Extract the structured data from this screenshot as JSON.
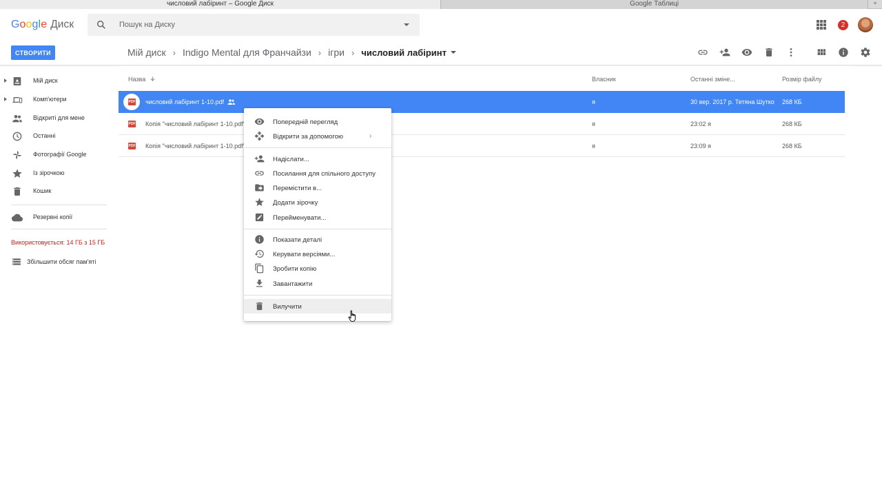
{
  "browser_tabs": [
    {
      "title": "числовий лабіринт – Google Диск",
      "active": true
    },
    {
      "title": "Google Таблиці",
      "active": false
    }
  ],
  "header": {
    "logo_google": "Google",
    "logo_app": "Диск",
    "search_placeholder": "Пошук на Диску",
    "notifications_count": "2",
    "create_label": "СТВОРИТИ",
    "breadcrumb": [
      "Мій диск",
      "Indigo Mental для Франчайзи",
      "ігри",
      "числовий лабіринт"
    ]
  },
  "toolbar_icons": [
    "link-icon",
    "add-person-icon",
    "preview-eye-icon",
    "trash-icon",
    "more-vert-icon",
    "grid-view-icon",
    "info-icon",
    "settings-icon"
  ],
  "sidebar": {
    "items": [
      {
        "label": "Мій диск",
        "icon": "drive-icon",
        "expandable": true
      },
      {
        "label": "Комп'ютери",
        "icon": "computers-icon",
        "expandable": true
      },
      {
        "label": "Відкриті для мене",
        "icon": "shared-people-icon",
        "expandable": false
      },
      {
        "label": "Останні",
        "icon": "clock-icon",
        "expandable": false
      },
      {
        "label": "Фотографії Google",
        "icon": "photos-pinwheel-icon",
        "expandable": false
      },
      {
        "label": "Із зірочкою",
        "icon": "star-icon",
        "expandable": false
      },
      {
        "label": "Кошик",
        "icon": "trash-icon",
        "expandable": false
      }
    ],
    "backups_label": "Резервні копії",
    "storage_text": "Використовується: 14 ГБ з 15 ГБ",
    "upgrade_label": "Збільшити обсяг пам'яті",
    "storage_color": "#c5221f"
  },
  "file_list": {
    "columns": {
      "name": "Назва",
      "owner": "Власник",
      "modified": "Останні зміне...",
      "size": "Розмір файлу"
    },
    "rows": [
      {
        "name": "числовий лабіринт 1-10.pdf",
        "owner": "я",
        "modified": "30 вер. 2017 р. Тетяна Шутко",
        "size": "268 КБ",
        "selected": true,
        "shared": true
      },
      {
        "name": "Копія \"числовий лабіринт 1-10.pdf\"",
        "owner": "я",
        "modified": "23:02 я",
        "size": "268 КБ",
        "selected": false,
        "shared": false
      },
      {
        "name": "Копія \"числовий лабіринт 1-10.pdf\"",
        "owner": "я",
        "modified": "23:09 я",
        "size": "268 КБ",
        "selected": false,
        "shared": false
      }
    ],
    "pdf_badge": "PDF",
    "selection_color": "#4285f4"
  },
  "context_menu": {
    "items": [
      {
        "label": "Попередній перегляд",
        "icon": "eye-icon"
      },
      {
        "label": "Відкрити за допомогою",
        "icon": "open-with-icon",
        "submenu": "›"
      },
      {
        "label": "Надіслати...",
        "icon": "add-person-icon"
      },
      {
        "label": "Посилання для спільного доступу",
        "icon": "link-icon"
      },
      {
        "label": "Перемістити в...",
        "icon": "move-folder-icon"
      },
      {
        "label": "Додати зірочку",
        "icon": "star-icon"
      },
      {
        "label": "Перейменувати...",
        "icon": "rename-pencil-icon"
      },
      {
        "label": "Показати деталі",
        "icon": "info-icon"
      },
      {
        "label": "Керувати версіями...",
        "icon": "history-icon"
      },
      {
        "label": "Зробити копію",
        "icon": "copy-icon"
      },
      {
        "label": "Завантажити",
        "icon": "download-icon"
      },
      {
        "label": "Вилучити",
        "icon": "trash-icon",
        "hovered": true
      }
    ]
  }
}
